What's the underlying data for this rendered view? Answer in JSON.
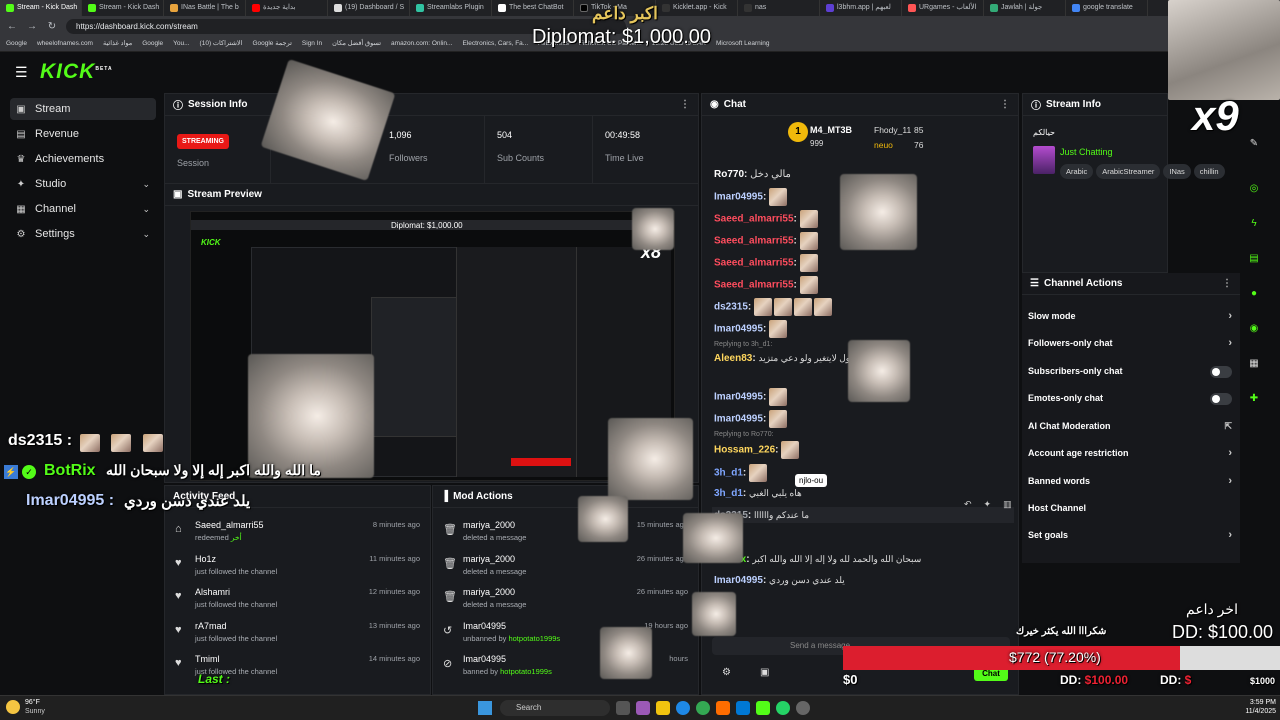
{
  "browser": {
    "tabs": [
      {
        "title": "Stream - Kick Dash",
        "active": true
      },
      {
        "title": "Stream - Kick Dash"
      },
      {
        "title": "INas Battle | The b"
      },
      {
        "title": "بداية جديدة"
      },
      {
        "title": "(19) Dashboard / S"
      },
      {
        "title": "Streamlabs Plugin"
      },
      {
        "title": "The best ChatBot"
      },
      {
        "title": "TikTok - Ma"
      },
      {
        "title": "Kicklet.app - Kick"
      },
      {
        "title": "nas"
      },
      {
        "title": "l3bhm.app | لعبهم"
      },
      {
        "title": "URgames - الألعاب"
      },
      {
        "title": "Jawlah | جولة"
      },
      {
        "title": "google translate"
      }
    ],
    "url": "https://dashboard.kick.com/stream",
    "bookmarks": [
      "Google",
      "wheelofnames.com",
      "مواد غذائية",
      "Google",
      "You...",
      "الاشتراكات (10)",
      "Google ترجمة",
      "Sign In",
      "تسوق أفضل مكان",
      "amazon.com: Onlin...",
      "Electronics, Cars, Fa...",
      "AliExpress",
      "Fishefest US Parcel...",
      "15.28 USD to SAR",
      "Microsoft Learning"
    ]
  },
  "app": {
    "logo": "KICK",
    "logo_beta": "BETA",
    "sidebar": [
      {
        "label": "Stream",
        "icon": "video-icon",
        "active": true
      },
      {
        "label": "Revenue",
        "icon": "revenue-icon"
      },
      {
        "label": "Achievements",
        "icon": "trophy-icon"
      },
      {
        "label": "Studio",
        "icon": "studio-icon",
        "chevron": true
      },
      {
        "label": "Channel",
        "icon": "channel-icon",
        "chevron": true
      },
      {
        "label": "Settings",
        "icon": "settings-icon",
        "chevron": true
      }
    ],
    "session_info": {
      "title": "Session Info",
      "badge": "STREAMING",
      "badge_label": "Session",
      "stats": [
        {
          "value": "1,096",
          "label": "Followers"
        },
        {
          "value": "504",
          "label": "Sub Counts"
        },
        {
          "value": "00:49:58",
          "label": "Time Live"
        }
      ]
    },
    "stream_preview": {
      "title": "Stream Preview"
    },
    "activity_feed": {
      "title": "Activity Feed",
      "rows": [
        {
          "name": "Saeed_almarri55",
          "sub": "redeemed",
          "reward": "أخر",
          "time": "8 minutes ago",
          "icon": "gift-icon"
        },
        {
          "name": "Ho1z",
          "sub": "just followed the channel",
          "time": "11 minutes ago",
          "icon": "heart-icon"
        },
        {
          "name": "Alshamri",
          "sub": "just followed the channel",
          "time": "12 minutes ago",
          "icon": "heart-icon"
        },
        {
          "name": "rA7mad",
          "sub": "just followed the channel",
          "time": "13 minutes ago",
          "icon": "heart-icon"
        },
        {
          "name": "Tmiml",
          "sub": "just followed the channel",
          "time": "14 minutes ago",
          "icon": "heart-icon"
        }
      ]
    },
    "mod_actions": {
      "title": "Mod Actions",
      "rows": [
        {
          "name": "mariya_2000",
          "sub": "deleted a message",
          "time": "15 minutes ago",
          "icon": "trash-icon"
        },
        {
          "name": "mariya_2000",
          "sub": "deleted a message",
          "time": "26 minutes ago",
          "icon": "trash-icon"
        },
        {
          "name": "mariya_2000",
          "sub": "deleted a message",
          "time": "26 minutes ago",
          "icon": "trash-icon"
        },
        {
          "name": "Imar04995",
          "sub": "unbanned by",
          "by": "hotpotato1999s",
          "time": "19 hours ago",
          "icon": "undo-icon"
        },
        {
          "name": "Imar04995",
          "sub": "banned by",
          "by": "hotpotato1999s",
          "time": "hours",
          "icon": "ban-icon"
        }
      ]
    },
    "chat": {
      "title": "Chat",
      "top_gifters": [
        {
          "name": "M4_MT3B",
          "amount": "999",
          "rank": "1"
        },
        {
          "name": "Fhody_11",
          "amount": "85"
        },
        {
          "name": "neuo",
          "amount": "76"
        }
      ],
      "messages": [
        {
          "user": "Ro770",
          "text": "مالي دخل",
          "color": "#ffffff"
        },
        {
          "user": "Imar04995",
          "text": "",
          "color": "#bcd0ff"
        },
        {
          "user": "Saeed_almarri55",
          "text": "",
          "color": "#ff4d5e"
        },
        {
          "user": "Saeed_almarri55",
          "text": "",
          "color": "#ff4d5e"
        },
        {
          "user": "Saeed_almarri55",
          "text": "",
          "color": "#ff4d5e"
        },
        {
          "user": "Saeed_almarri55",
          "text": "",
          "color": "#ff4d5e"
        },
        {
          "user": "ds2315",
          "text": "",
          "color": "#bcd0ff"
        },
        {
          "user": "Imar04995",
          "text": "",
          "color": "#bcd0ff"
        },
        {
          "user": "Aleen83",
          "text": "الميول لايتغير ولو دعي متزيد",
          "color": "#ffd75e",
          "reply": "Replying to 3h_d1:"
        },
        {
          "user": "Imar04995",
          "text": "",
          "color": "#bcd0ff"
        },
        {
          "user": "Imar04995",
          "text": "",
          "color": "#bcd0ff"
        },
        {
          "user": "Hossam_226",
          "text": "",
          "color": "#ffd75e",
          "reply": "Replying to Ro770:"
        },
        {
          "user": "3h_d1",
          "text": "",
          "color": "#7fa6ff"
        },
        {
          "user": "3h_d1",
          "text": "هاه يلبي الغبي",
          "color": "#7fa6ff"
        },
        {
          "user": "ds2315",
          "text": "ما عندكم واااااا",
          "color": "#9ea2a8"
        },
        {
          "user": "BotRix",
          "text": "سبحان الله والحمد لله ولا إله إلا الله والله اكبر",
          "color": "#53fc18"
        },
        {
          "user": "Imar04995",
          "text": "يلد عندي دسن وردي",
          "color": "#bcd0ff"
        }
      ],
      "tooltip": "njlo-ou",
      "input_placeholder": "Send a message",
      "send_label": "Chat"
    },
    "stream_info": {
      "title": "Stream Info",
      "stream_title": "حيالكم",
      "category": "Just Chatting",
      "tags": [
        "Arabic",
        "ArabicStreamer",
        "INas",
        "chillin"
      ]
    },
    "channel_actions": {
      "title": "Channel Actions",
      "rows": [
        {
          "label": "Slow mode",
          "control": "chevron"
        },
        {
          "label": "Followers-only chat",
          "control": "chevron"
        },
        {
          "label": "Subscribers-only chat",
          "control": "toggle"
        },
        {
          "label": "Emotes-only chat",
          "control": "toggle"
        },
        {
          "label": "AI Chat Moderation",
          "control": "external"
        },
        {
          "label": "Account age restriction",
          "control": "chevron"
        },
        {
          "label": "Banned words",
          "control": "chevron"
        },
        {
          "label": "Host Channel",
          "control": "none"
        },
        {
          "label": "Set goals",
          "control": "chevron"
        }
      ]
    }
  },
  "overlays": {
    "top_donor_label": "اكبر داعم",
    "top_donor": "Diplomat: $1,000.00",
    "multiplier": "x9",
    "preview_multiplier": "x8",
    "chat_ds2315": "ds2315 :",
    "chat_botrix_name": "BotRix",
    "chat_botrix_text": "ما الله والله اكبر إله إلا ولا سبحان الله",
    "chat_imar_name": "Imar04995 :",
    "chat_imar_text": "يلد عندي دسن وردي",
    "last_donor_label": "اخر داعم",
    "last_donor": "DD: $100.00",
    "goal_progress": "$772 (77.20%)",
    "goal_fraction": 0.772,
    "thanks_text": "شكرااا الله يكثر خيرك",
    "ticker": [
      {
        "name": "DD:",
        "amount": "$100.00"
      },
      {
        "name": "DD:",
        "amount": "$"
      }
    ],
    "goal_end": "$1000",
    "goal_start": "$0",
    "last_label": "Last :"
  },
  "taskbar": {
    "weather_temp": "96°F",
    "weather_desc": "Sunny",
    "search": "Search",
    "time": "3:59 PM",
    "date": "11/4/2025"
  }
}
